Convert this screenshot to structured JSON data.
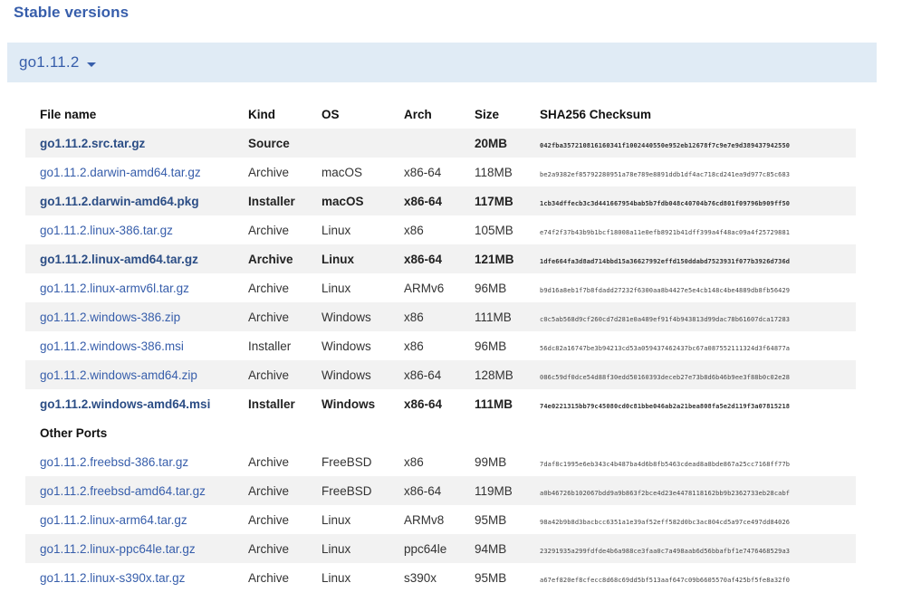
{
  "page": {
    "title": "Stable versions"
  },
  "version_selector": {
    "label": "go1.11.2",
    "caret_icon": "chevron-down-icon"
  },
  "table": {
    "columns": [
      {
        "key": "file_name",
        "label": "File name"
      },
      {
        "key": "kind",
        "label": "Kind"
      },
      {
        "key": "os",
        "label": "OS"
      },
      {
        "key": "arch",
        "label": "Arch"
      },
      {
        "key": "size",
        "label": "Size"
      },
      {
        "key": "checksum",
        "label": "SHA256 Checksum"
      }
    ],
    "rows": [
      {
        "file_name": "go1.11.2.src.tar.gz",
        "kind": "Source",
        "os": "",
        "arch": "",
        "size": "20MB",
        "checksum": "042fba357210816160341f1002440550e952eb12678f7c9e7e9d389437942550",
        "highlight": true,
        "striped": true
      },
      {
        "file_name": "go1.11.2.darwin-amd64.tar.gz",
        "kind": "Archive",
        "os": "macOS",
        "arch": "x86-64",
        "size": "118MB",
        "checksum": "be2a9382ef85792280951a78e789e8891ddb1df4ac718cd241ea9d977c85c683",
        "highlight": false,
        "striped": false
      },
      {
        "file_name": "go1.11.2.darwin-amd64.pkg",
        "kind": "Installer",
        "os": "macOS",
        "arch": "x86-64",
        "size": "117MB",
        "checksum": "1cb34dffecb3c3d441667954bab5b7fdb048c40704b76cd801f09796b909ff50",
        "highlight": true,
        "striped": true
      },
      {
        "file_name": "go1.11.2.linux-386.tar.gz",
        "kind": "Archive",
        "os": "Linux",
        "arch": "x86",
        "size": "105MB",
        "checksum": "e74f2f37b43b9b1bcf18008a11e0efb8921b41dff399a4f48ac09a4f25729881",
        "highlight": false,
        "striped": false
      },
      {
        "file_name": "go1.11.2.linux-amd64.tar.gz",
        "kind": "Archive",
        "os": "Linux",
        "arch": "x86-64",
        "size": "121MB",
        "checksum": "1dfe664fa3d8ad714bbd15a36627992effd150ddabd7523931f077b3926d736d",
        "highlight": true,
        "striped": true
      },
      {
        "file_name": "go1.11.2.linux-armv6l.tar.gz",
        "kind": "Archive",
        "os": "Linux",
        "arch": "ARMv6",
        "size": "96MB",
        "checksum": "b9d16a8eb1f7b8fdadd27232f6300aa8b4427e5e4cb148c4be4889db8fb56429",
        "highlight": false,
        "striped": false
      },
      {
        "file_name": "go1.11.2.windows-386.zip",
        "kind": "Archive",
        "os": "Windows",
        "arch": "x86",
        "size": "111MB",
        "checksum": "c0c5ab568d9cf260cd7d281e0a489ef91f4b943813d99dac78b61607dca17283",
        "highlight": false,
        "striped": true
      },
      {
        "file_name": "go1.11.2.windows-386.msi",
        "kind": "Installer",
        "os": "Windows",
        "arch": "x86",
        "size": "96MB",
        "checksum": "56dc82a16747be3b94213cd53a059437462437bc67a087552111324d3f64877a",
        "highlight": false,
        "striped": false
      },
      {
        "file_name": "go1.11.2.windows-amd64.zip",
        "kind": "Archive",
        "os": "Windows",
        "arch": "x86-64",
        "size": "128MB",
        "checksum": "086c59df0dce54d88f30edd50160393deceb27e73b8d6b46b9ee3f88b0c02e28",
        "highlight": false,
        "striped": true
      },
      {
        "file_name": "go1.11.2.windows-amd64.msi",
        "kind": "Installer",
        "os": "Windows",
        "arch": "x86-64",
        "size": "111MB",
        "checksum": "74e0221315bb79c45080cd0c81bbe046ab2a21bea808fa5e2d119f3a07815218",
        "highlight": true,
        "striped": false
      }
    ],
    "other_ports_header": "Other Ports",
    "other_ports_rows": [
      {
        "file_name": "go1.11.2.freebsd-386.tar.gz",
        "kind": "Archive",
        "os": "FreeBSD",
        "arch": "x86",
        "size": "99MB",
        "checksum": "7daf8c1995e6eb343c4b487ba4d6b8fb5463cdead8a8bde867a25cc7168ff77b",
        "highlight": false,
        "striped": false
      },
      {
        "file_name": "go1.11.2.freebsd-amd64.tar.gz",
        "kind": "Archive",
        "os": "FreeBSD",
        "arch": "x86-64",
        "size": "119MB",
        "checksum": "a0b46726b102067bdd9a9b863f2bce4d23e4478118162bb9b2362733eb28cabf",
        "highlight": false,
        "striped": true
      },
      {
        "file_name": "go1.11.2.linux-arm64.tar.gz",
        "kind": "Archive",
        "os": "Linux",
        "arch": "ARMv8",
        "size": "95MB",
        "checksum": "98a42b9b8d3bacbcc6351a1e39af52eff582d0bc3ac804cd5a97ce497dd84026",
        "highlight": false,
        "striped": false
      },
      {
        "file_name": "go1.11.2.linux-ppc64le.tar.gz",
        "kind": "Archive",
        "os": "Linux",
        "arch": "ppc64le",
        "size": "94MB",
        "checksum": "23291935a299fdfde4b6a988ce3faa0c7a498aab6d56bbafbf1e7476468529a3",
        "highlight": false,
        "striped": true
      },
      {
        "file_name": "go1.11.2.linux-s390x.tar.gz",
        "kind": "Archive",
        "os": "Linux",
        "arch": "s390x",
        "size": "95MB",
        "checksum": "a67ef820ef8cfecc8d68c69dd5bf513aaf647c09b6605570af425bf5fe8a32f0",
        "highlight": false,
        "striped": false
      }
    ]
  },
  "colors": {
    "accent": "#375eab",
    "banner_bg": "#e0ebf5",
    "stripe_bg": "#f2f2f2"
  }
}
